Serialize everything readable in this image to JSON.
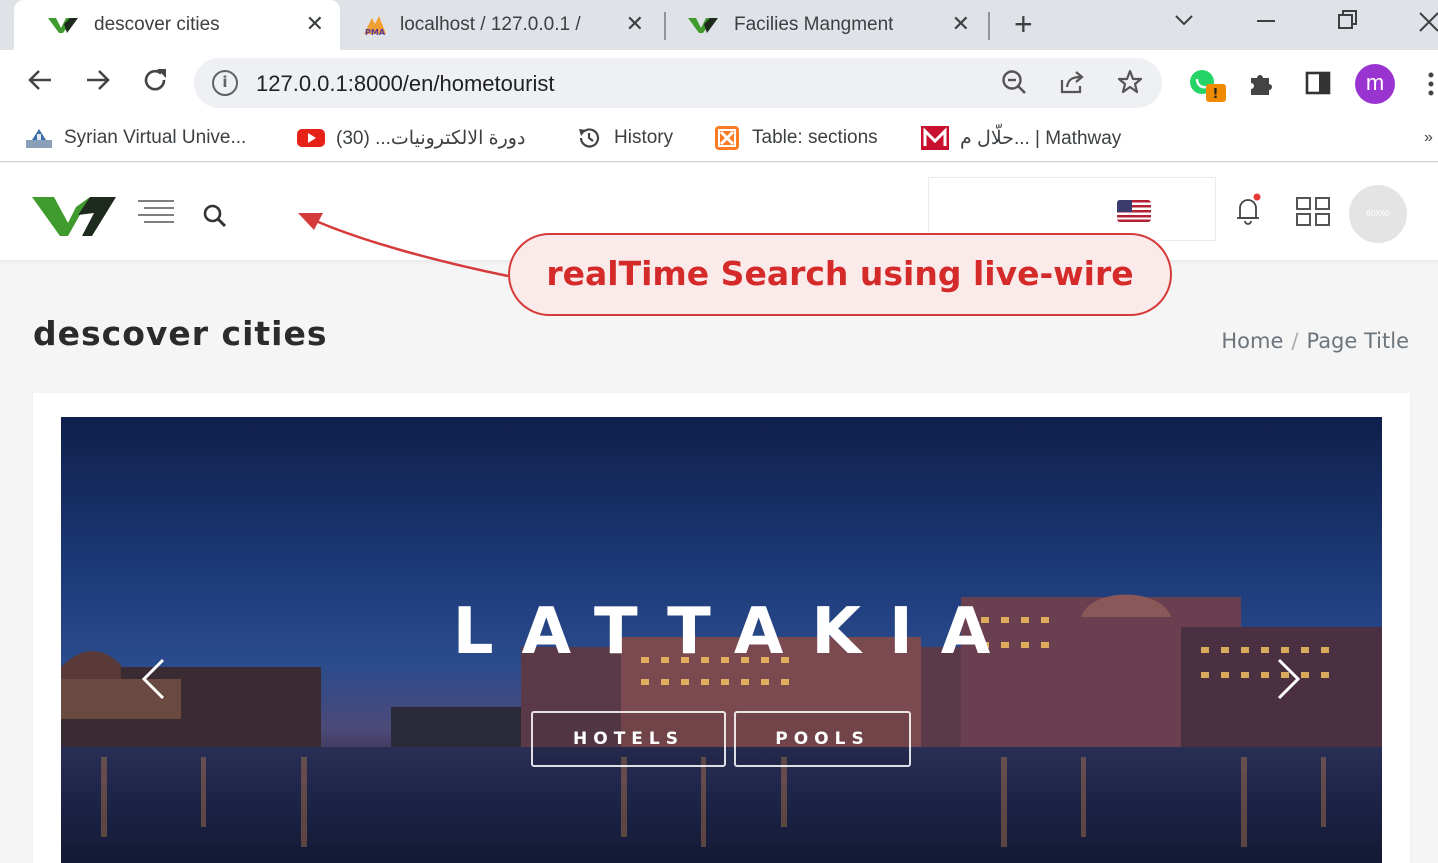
{
  "browser": {
    "tabs": [
      {
        "title": "descover cities",
        "favicon": "vaspire-logo-icon",
        "active": true
      },
      {
        "title": "localhost / 127.0.0.1 /",
        "favicon": "phpmyadmin-icon",
        "active": false
      },
      {
        "title": "Facilies Mangment",
        "favicon": "vaspire-logo-icon",
        "active": false
      }
    ],
    "close_glyph": "✕",
    "url": "127.0.0.1:8000/en/hometourist",
    "profile_initial": "m",
    "bookmarks": [
      {
        "label": "Syrian Virtual Unive...",
        "icon": "svu-icon"
      },
      {
        "label": "دورة الالكترونيات... (30)",
        "icon": "youtube-icon"
      },
      {
        "label": "History",
        "icon": "history-icon"
      },
      {
        "label": "Table: sections",
        "icon": "xampp-icon"
      },
      {
        "label": "حلّال م... | Mathway",
        "icon": "mathway-icon"
      }
    ],
    "bookmarks_overflow": "»"
  },
  "header": {
    "avatar_text": "60X60",
    "flag": "us-flag-icon"
  },
  "page": {
    "title": "descover cities",
    "breadcrumb": {
      "home": "Home",
      "separator": "/",
      "current": "Page Title"
    }
  },
  "slider": {
    "title": "LATTAKIA",
    "buttons": [
      "HOTELS",
      "POOLS"
    ]
  },
  "annotation": {
    "text": "realTime Search using live-wire",
    "color": "#d63b3b"
  },
  "colors": {
    "brand_green": "#3f9b2d",
    "brand_dark": "#1f2a1f"
  }
}
